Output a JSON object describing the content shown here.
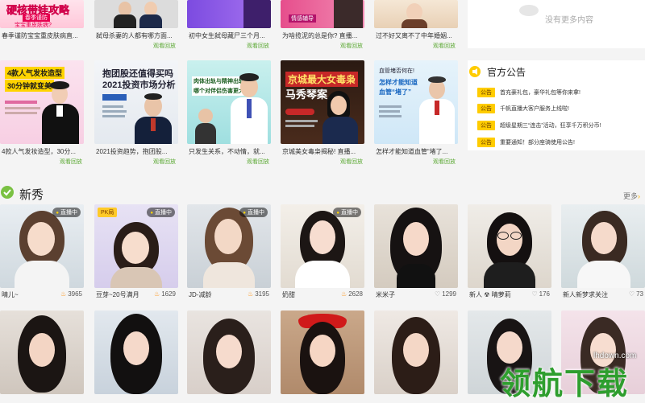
{
  "top_row": [
    {
      "title": "春季谨防宝宝重皮肤病直...",
      "cover": "硬核带娃攻略 春季谨防 宝宝重皮肤病?",
      "replay": ""
    },
    {
      "title": "弑母杀妻的人都有哪方面...",
      "replay": "观看回放"
    },
    {
      "title": "初中女生弑母藏尸三个月...",
      "replay": "观看回放"
    },
    {
      "title": "为啥揽泥的总是你? 直播...",
      "replay": "观看回放"
    },
    {
      "title": "过不好又离不了中年婚姻...",
      "replay": "观看回放"
    }
  ],
  "no_more": "没有更多内容",
  "row2": [
    {
      "title": "4款人气发妆造型，30分...",
      "cover": "4款人气发妆造型 30分钟就变美",
      "replay": "观看回放"
    },
    {
      "title": "2021投资趋势，抱团股...",
      "cover": "抱团股还值得买吗 2021投资市场分析",
      "replay": "观看回放"
    },
    {
      "title": "只发生关系，不动情，就...",
      "cover": "肉体出轨与精神出轨 哪个对伴侣伤害更大?",
      "replay": "观看回放"
    },
    {
      "title": "京城美女毒枭揭秘! 直播...",
      "cover": "京城最大女毒枭 马秀琴案",
      "replay": "观看回放"
    },
    {
      "title": "怎样才能知道血管“堵了...",
      "cover": "血管堵否何在! 怎样才能知道 血管“堵了”",
      "replay": "观看回放"
    }
  ],
  "notice": {
    "title": "官方公告",
    "tag": "公告",
    "items": [
      "首充豪礼包，豪华礼包等你来拿!",
      "千帆直播大客户服务上线啦!",
      "超级星期三“连击”活动，狂享千万积分币!",
      "重要通知！部分座骑使用公告!"
    ]
  },
  "section": {
    "title": "新秀",
    "more": "更多"
  },
  "stars": [
    {
      "name": "晴儿~",
      "count": "3965",
      "badge": "直播中",
      "icon": "fire"
    },
    {
      "name": "豆芽~20号满月",
      "count": "1629",
      "badge": "直播中",
      "pk": "PK局",
      "icon": "fire"
    },
    {
      "name": "JD-减龄",
      "count": "3195",
      "badge": "直播中",
      "icon": "fire"
    },
    {
      "name": "奶甜",
      "count": "2628",
      "badge": "直播中",
      "icon": "fire"
    },
    {
      "name": "米米子",
      "count": "1299",
      "badge": "",
      "icon": "heart"
    },
    {
      "name": "新人 ☢ 晴萝莉",
      "count": "176",
      "badge": "",
      "icon": "heart"
    },
    {
      "name": "新人新梦求关注",
      "count": "73",
      "badge": "",
      "icon": "heart"
    }
  ],
  "watermark": {
    "text": "领航下载",
    "site": "lhdown.com"
  },
  "colors": {
    "accent": "#ffcc00",
    "green": "#5aa832",
    "section_icon": "#7ac143"
  }
}
